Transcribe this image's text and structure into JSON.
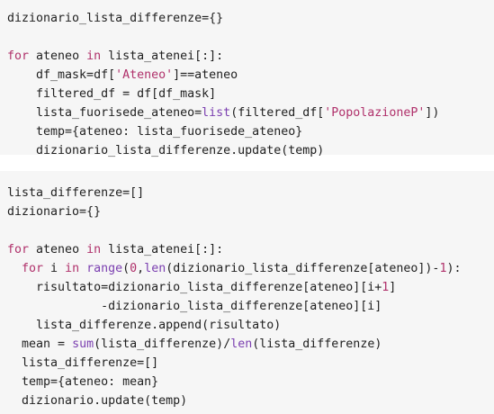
{
  "code_blocks": [
    {
      "lines": [
        [
          [
            "pl",
            "dizionario_lista_differenze={}"
          ]
        ],
        [],
        [
          [
            "kw",
            "for"
          ],
          [
            "pl",
            " ateneo "
          ],
          [
            "kw",
            "in"
          ],
          [
            "pl",
            " lista_atenei[:]:"
          ]
        ],
        [
          [
            "pl",
            "    df_mask=df["
          ],
          [
            "str",
            "'Ateneo'"
          ],
          [
            "pl",
            "]==ateneo"
          ]
        ],
        [
          [
            "pl",
            "    filtered_df = df[df_mask]"
          ]
        ],
        [
          [
            "pl",
            "    lista_fuorisede_ateneo="
          ],
          [
            "fn",
            "list"
          ],
          [
            "pl",
            "(filtered_df["
          ],
          [
            "str",
            "'PopolazioneP'"
          ],
          [
            "pl",
            "])"
          ]
        ],
        [
          [
            "pl",
            "    temp={ateneo: lista_fuorisede_ateneo}"
          ]
        ],
        [
          [
            "pl",
            "    dizionario_lista_differenze.update(temp)"
          ]
        ]
      ]
    },
    {
      "lines": [
        [
          [
            "pl",
            "lista_differenze=[]"
          ]
        ],
        [
          [
            "pl",
            "dizionario={}"
          ]
        ],
        [],
        [
          [
            "kw",
            "for"
          ],
          [
            "pl",
            " ateneo "
          ],
          [
            "kw",
            "in"
          ],
          [
            "pl",
            " lista_atenei[:]:"
          ]
        ],
        [
          [
            "pl",
            "  "
          ],
          [
            "kw",
            "for"
          ],
          [
            "pl",
            " i "
          ],
          [
            "kw",
            "in"
          ],
          [
            "pl",
            " "
          ],
          [
            "fn",
            "range"
          ],
          [
            "pl",
            "("
          ],
          [
            "num",
            "0"
          ],
          [
            "pl",
            ","
          ],
          [
            "fn",
            "len"
          ],
          [
            "pl",
            "(dizionario_lista_differenze[ateneo])-"
          ],
          [
            "num",
            "1"
          ],
          [
            "pl",
            "):"
          ]
        ],
        [
          [
            "pl",
            "    risultato=dizionario_lista_differenze[ateneo][i+"
          ],
          [
            "num",
            "1"
          ],
          [
            "pl",
            "]"
          ]
        ],
        [
          [
            "pl",
            "             -dizionario_lista_differenze[ateneo][i]"
          ]
        ],
        [
          [
            "pl",
            "    lista_differenze.append(risultato)"
          ]
        ],
        [
          [
            "pl",
            "  mean = "
          ],
          [
            "fn",
            "sum"
          ],
          [
            "pl",
            "(lista_differenze)/"
          ],
          [
            "fn",
            "len"
          ],
          [
            "pl",
            "(lista_differenze)"
          ]
        ],
        [
          [
            "pl",
            "  lista_differenze=[]"
          ]
        ],
        [
          [
            "pl",
            "  temp={ateneo: mean}"
          ]
        ],
        [
          [
            "pl",
            "  dizionario.update(temp)"
          ]
        ]
      ]
    }
  ]
}
